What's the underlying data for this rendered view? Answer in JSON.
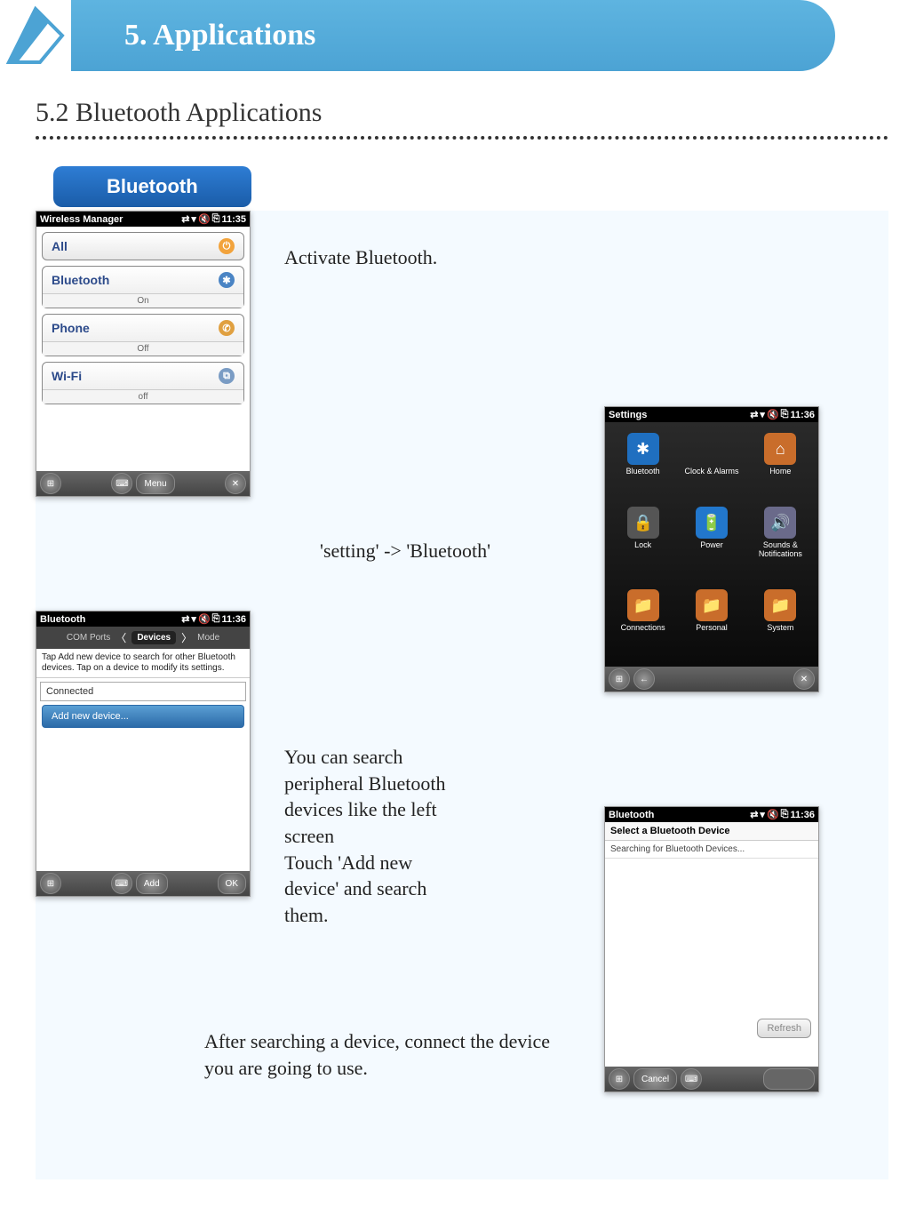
{
  "header": {
    "title": "5. Applications"
  },
  "section": {
    "title": "5.2 Bluetooth Applications",
    "badge": "Bluetooth"
  },
  "texts": {
    "activate": "Activate Bluetooth.",
    "path": "'setting' -> 'Bluetooth'",
    "search1": "You can search peripheral Bluetooth devices like the left screen",
    "search2": "Touch 'Add new device' and search them.",
    "aftersearch": "After searching a device, connect the device you are going to use."
  },
  "wm": {
    "title": "Wireless Manager",
    "time": "11:35",
    "rows": [
      {
        "label": "All",
        "status": ""
      },
      {
        "label": "Bluetooth",
        "status": "On"
      },
      {
        "label": "Phone",
        "status": "Off"
      },
      {
        "label": "Wi-Fi",
        "status": "off"
      }
    ],
    "menu": "Menu"
  },
  "settings": {
    "title": "Settings",
    "time": "11:36",
    "tiles": [
      {
        "label": "Bluetooth",
        "color": "#1f6fc0",
        "icon": "✱"
      },
      {
        "label": "",
        "color": "",
        "icon": ""
      },
      {
        "label": "Home",
        "color": "#c96d2b",
        "icon": "⌂"
      },
      {
        "label": "Lock",
        "color": "#555",
        "icon": "🔒"
      },
      {
        "label": "Clock & Alarms",
        "color": "",
        "icon": ""
      },
      {
        "label": "Sounds & Notifications",
        "color": "#6a6a8a",
        "icon": "🔊"
      },
      {
        "label": "Connections",
        "color": "#c96d2b",
        "icon": "📁"
      },
      {
        "label": "Power",
        "color": "#2277cc",
        "icon": "🔋"
      },
      {
        "label": "System",
        "color": "#c96d2b",
        "icon": "📁"
      },
      {
        "label": "",
        "color": "",
        "icon": ""
      },
      {
        "label": "Personal",
        "color": "#c96d2b",
        "icon": "📁"
      },
      {
        "label": "",
        "color": "",
        "icon": ""
      }
    ]
  },
  "btdev": {
    "title": "Bluetooth",
    "time": "11:36",
    "tab_left": "COM Ports",
    "tab_mid": "Devices",
    "tab_right": "Mode",
    "instr": "Tap Add new device to search for other Bluetooth devices. Tap on a device to modify its settings.",
    "connected": "Connected",
    "addbtn": "Add new device...",
    "add": "Add",
    "ok": "OK"
  },
  "sel": {
    "title": "Bluetooth",
    "time": "11:36",
    "header": "Select a Bluetooth Device",
    "searching": "Searching for Bluetooth Devices...",
    "refresh": "Refresh",
    "cancel": "Cancel"
  }
}
